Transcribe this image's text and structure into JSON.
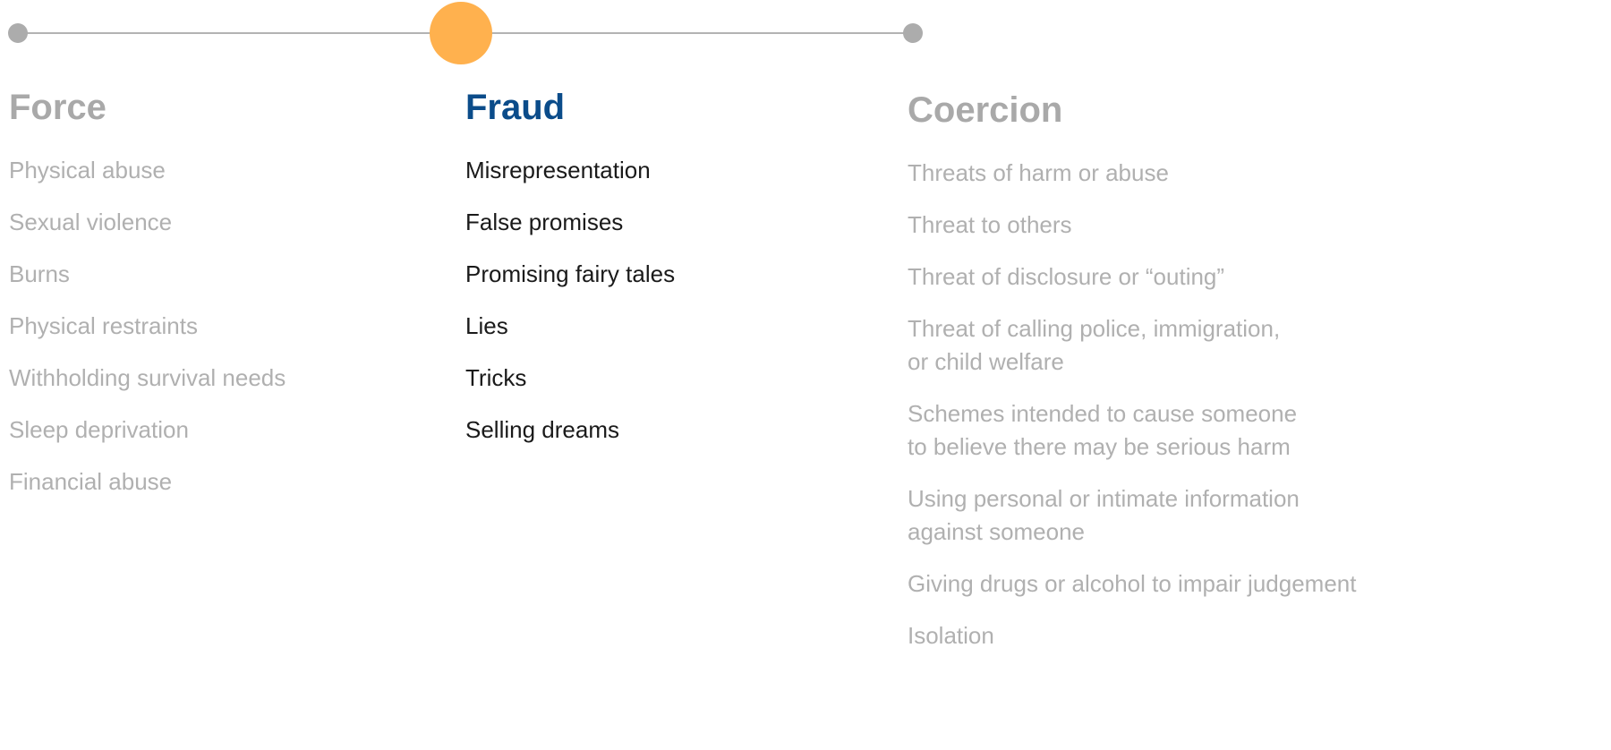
{
  "colors": {
    "active_heading": "#0b4c8a",
    "inactive_heading": "#a9a9a9",
    "active_text": "#1a1a1a",
    "inactive_text": "#b0b0b0",
    "active_node": "#ffb14e",
    "inactive_node": "#acacac",
    "line": "#b3b3b3"
  },
  "timeline": {
    "steps": [
      "Force",
      "Fraud",
      "Coercion"
    ],
    "active_step": "Fraud"
  },
  "columns": [
    {
      "heading": "Force",
      "active": false,
      "items": [
        "Physical abuse",
        "Sexual violence",
        "Burns",
        "Physical restraints",
        "Withholding survival needs",
        "Sleep deprivation",
        "Financial abuse"
      ]
    },
    {
      "heading": "Fraud",
      "active": true,
      "items": [
        "Misrepresentation",
        "False promises",
        "Promising fairy tales",
        "Lies",
        "Tricks",
        "Selling dreams"
      ]
    },
    {
      "heading": "Coercion",
      "active": false,
      "items": [
        "Threats of harm or abuse",
        "Threat to others",
        "Threat of disclosure or “outing”",
        "Threat of calling police, immigration,\nor child welfare",
        "Schemes intended to cause someone\nto believe there may be serious harm",
        "Using personal or intimate information\nagainst someone",
        "Giving drugs or alcohol to impair judgement",
        "Isolation"
      ]
    }
  ]
}
